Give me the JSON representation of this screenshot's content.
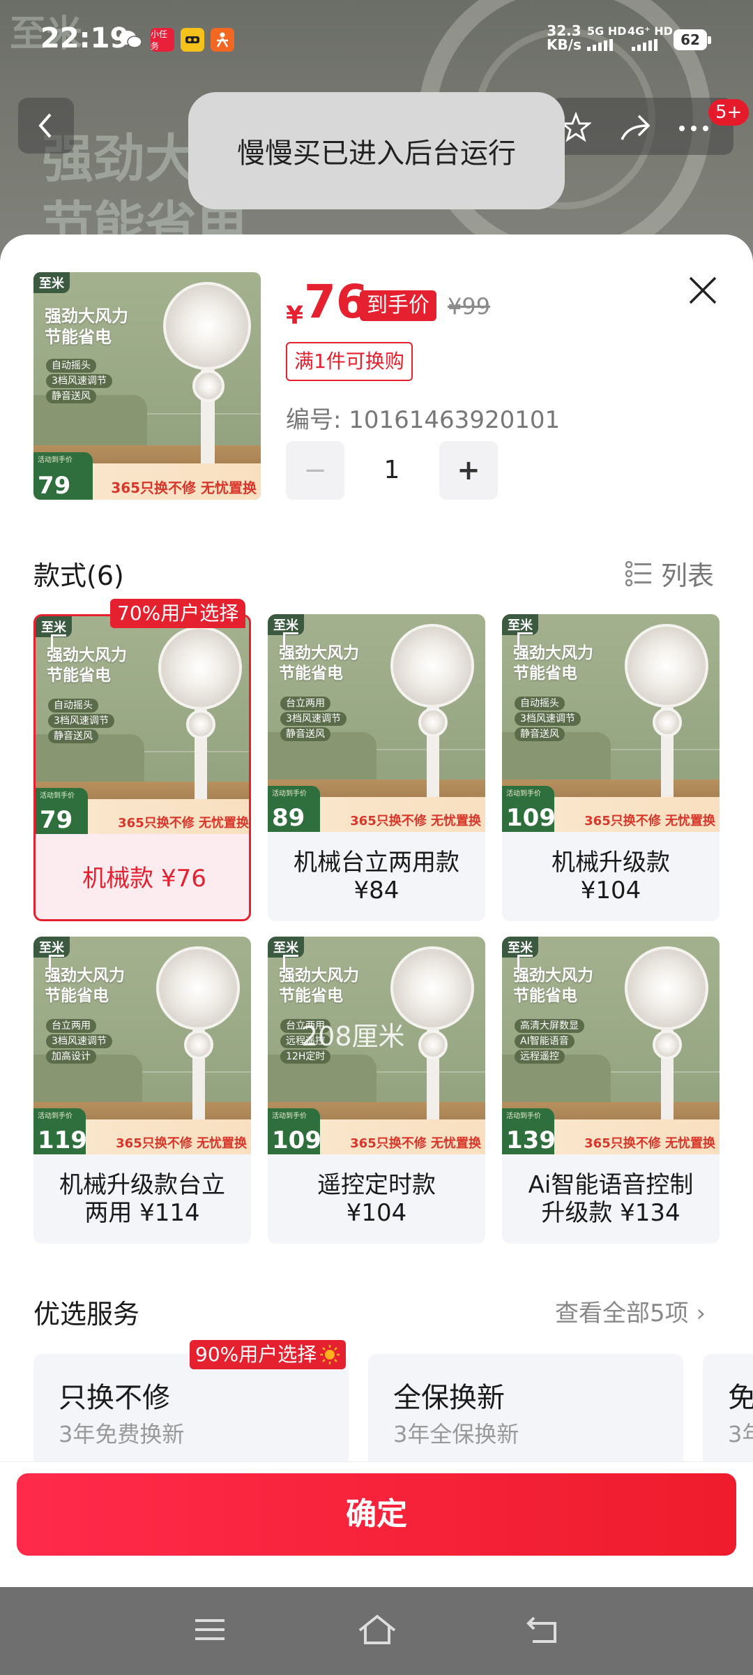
{
  "status_bar": {
    "time": "22:19",
    "app_icons": [
      {
        "name": "wechat-icon",
        "label": "",
        "color": "#6f6f6f"
      },
      {
        "name": "mini-task-icon",
        "label": "小任务",
        "color": "#e8203a"
      },
      {
        "name": "app-yellow-icon",
        "label": "",
        "color": "#f4c21a"
      },
      {
        "name": "app-orange-icon",
        "label": "",
        "color": "#f26722"
      }
    ],
    "net_speed_value": "32.3",
    "net_speed_unit": "KB/s",
    "sim1": "5G HD",
    "sim2": "4G⁺ HD",
    "battery": "62"
  },
  "background_page": {
    "brand": "至米",
    "headline": "强劲大风力\n节能省电",
    "cart_badge": "5+"
  },
  "toast": {
    "text": "慢慢买已进入后台运行"
  },
  "sheet": {
    "currency": "¥",
    "price": "76",
    "price_tag": "到手价",
    "original_price": "¥99",
    "promo_tag": "满1件可换购",
    "sku_number": "编号: 10161463920101",
    "quantity": "1",
    "qty_minus": "−",
    "qty_plus": "+",
    "thumbnail": {
      "brand": "至米",
      "headline": "强劲大风力\n节能省电",
      "features": [
        "自动摇头",
        "3档风速调节",
        "静音送风"
      ],
      "price_label": "活动到手价",
      "price": "79",
      "guarantee": "365只换不修 无忧置换"
    }
  },
  "variants": {
    "title": "款式(6)",
    "list_toggle_label": "列表",
    "pick_badge": "70%用户选择",
    "image_overlay_text": "208厘米",
    "items": [
      {
        "label": "机械款 ¥76",
        "img_price": "79",
        "features": [
          "自动摇头",
          "3档风速调节",
          "静音送风"
        ],
        "selected": true
      },
      {
        "label": "机械台立两用款\n¥84",
        "img_price": "89",
        "features": [
          "台立两用",
          "3档风速调节",
          "静音送风"
        ],
        "selected": false
      },
      {
        "label": "机械升级款\n¥104",
        "img_price": "109",
        "features": [
          "自动摇头",
          "3档风速调节",
          "静音送风"
        ],
        "selected": false
      },
      {
        "label": "机械升级款台立\n两用 ¥114",
        "img_price": "119",
        "features": [
          "台立两用",
          "3档风速调节",
          "加高设计"
        ],
        "selected": false
      },
      {
        "label": "遥控定时款\n¥104",
        "img_price": "109",
        "features": [
          "台立两用",
          "远程遥控",
          "12H定时"
        ],
        "selected": false
      },
      {
        "label": "Ai智能语音控制\n升级款 ¥134",
        "img_price": "139",
        "features": [
          "高清大屏数显",
          "AI智能语音",
          "远程遥控"
        ],
        "selected": false
      }
    ],
    "img_brand": "至米",
    "img_headline": "强劲大风力\n节能省电",
    "img_price_label": "活动到手价",
    "img_guarantee": "365只换不修 无忧置换"
  },
  "services": {
    "title": "优选服务",
    "view_all": "查看全部5项 ›",
    "badge": "90%用户选择",
    "items": [
      {
        "title": "只换不修",
        "subtitle": "3年免费换新"
      },
      {
        "title": "全保换新",
        "subtitle": "3年全保换新"
      },
      {
        "title": "免",
        "subtitle": "3年"
      }
    ]
  },
  "confirm": {
    "label": "确定"
  },
  "colors": {
    "accent_red": "#e5202f",
    "selected_bg": "#fdecef",
    "card_bg": "#f4f5f9"
  }
}
